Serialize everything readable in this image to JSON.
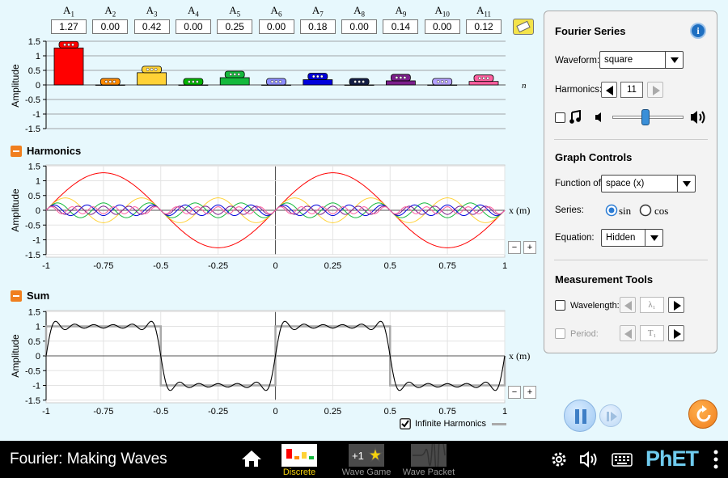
{
  "amplitudes": [
    {
      "label": "A",
      "sub": "1",
      "value": "1.27"
    },
    {
      "label": "A",
      "sub": "2",
      "value": "0.00"
    },
    {
      "label": "A",
      "sub": "3",
      "value": "0.42"
    },
    {
      "label": "A",
      "sub": "4",
      "value": "0.00"
    },
    {
      "label": "A",
      "sub": "5",
      "value": "0.25"
    },
    {
      "label": "A",
      "sub": "6",
      "value": "0.00"
    },
    {
      "label": "A",
      "sub": "7",
      "value": "0.18"
    },
    {
      "label": "A",
      "sub": "8",
      "value": "0.00"
    },
    {
      "label": "A",
      "sub": "9",
      "value": "0.14"
    },
    {
      "label": "A",
      "sub": "10",
      "value": "0.00"
    },
    {
      "label": "A",
      "sub": "11",
      "value": "0.12"
    }
  ],
  "colors": {
    "harmonics": [
      "#ff0000",
      "#ff8a00",
      "#ffd236",
      "#00b400",
      "#14b93c",
      "#8c8cff",
      "#0000dc",
      "#141e46",
      "#7c1e8c",
      "#b4a0ff",
      "#ff60a0"
    ],
    "accent": "#f07f1f",
    "sum_curve": "#000000",
    "infinite_curve": "#aaaaaa"
  },
  "amplitude_chart": {
    "ylabel": "Amplitude",
    "yticks": [
      "1.5",
      "1",
      "0.5",
      "0",
      "-0.5",
      "-1",
      "-1.5"
    ],
    "axis_label": "n"
  },
  "harmonics_chart": {
    "title": "Harmonics",
    "ylabel": "Amplitude",
    "xlabel": "x (m)",
    "yticks": [
      "1.5",
      "1",
      "0.5",
      "0",
      "-0.5",
      "-1",
      "-1.5"
    ],
    "xticks": [
      "-1",
      "-0.75",
      "-0.5",
      "-0.25",
      "0",
      "0.25",
      "0.5",
      "0.75",
      "1"
    ]
  },
  "sum_chart": {
    "title": "Sum",
    "ylabel": "Amplitude",
    "xlabel": "x (m)",
    "yticks": [
      "1.5",
      "1",
      "0.5",
      "0",
      "-0.5",
      "-1",
      "-1.5"
    ],
    "xticks": [
      "-1",
      "-0.75",
      "-0.5",
      "-0.25",
      "0",
      "0.25",
      "0.5",
      "0.75",
      "1"
    ],
    "infinite_label": "Infinite Harmonics",
    "infinite_checked": true
  },
  "zoom": {
    "out": "−",
    "in": "+"
  },
  "panel": {
    "fourier_title": "Fourier Series",
    "waveform_label": "Waveform:",
    "waveform_value": "square",
    "harmonics_label": "Harmonics:",
    "harmonics_value": "11",
    "graph_title": "Graph Controls",
    "function_label": "Function of:",
    "function_value": "space (x)",
    "series_label": "Series:",
    "series_sin": "sin",
    "series_cos": "cos",
    "equation_label": "Equation:",
    "equation_value": "Hidden",
    "measure_title": "Measurement Tools",
    "wavelength_label": "Wavelength:",
    "wavelength_value": "λ₁",
    "period_label": "Period:",
    "period_value": "T₁"
  },
  "navbar": {
    "title": "Fourier: Making Waves",
    "screens": [
      "Discrete",
      "Wave Game",
      "Wave Packet"
    ],
    "wave_game_badge": "+1",
    "brand": "PhET"
  }
}
